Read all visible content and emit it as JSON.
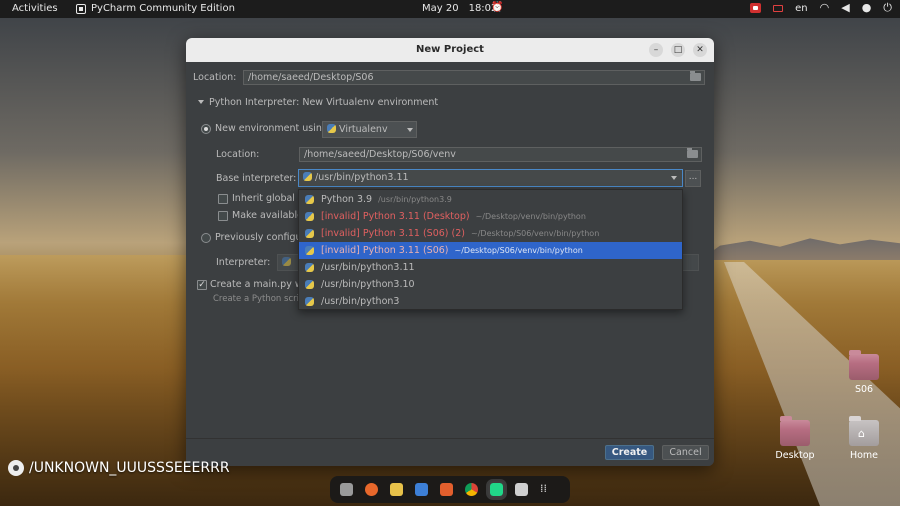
{
  "topbar": {
    "activities": "Activities",
    "app_name": "PyCharm Community Edition",
    "date": "May 20",
    "time": "18:02",
    "language": "en"
  },
  "dialog": {
    "title": "New Project",
    "location_label": "Location:",
    "location_value": "/home/saeed/Desktop/S06",
    "interpreter_section": "Python Interpreter: New Virtualenv environment",
    "new_env_label": "New environment using",
    "env_tool": "Virtualenv",
    "venv_location_label": "Location:",
    "venv_location_value": "/home/saeed/Desktop/S06/venv",
    "base_interpreter_label": "Base interpreter:",
    "base_interpreter_value": "/usr/bin/python3.11",
    "inherit_label": "Inherit global si",
    "make_available_label": "Make available",
    "previously_configured_label": "Previously configur",
    "interpreter_label": "Interpreter:",
    "create_main_label": "Create a main.py we",
    "create_main_hint": "Create a Python script",
    "create_button": "Create",
    "cancel_button": "Cancel",
    "dots_button": "..."
  },
  "popup": {
    "items": [
      {
        "name": "Python 3.9",
        "path": "/usr/bin/python3.9",
        "invalid": false,
        "selected": false
      },
      {
        "name": "[invalid] Python 3.11 (Desktop)",
        "path": "~/Desktop/venv/bin/python",
        "invalid": true,
        "selected": false
      },
      {
        "name": "[invalid] Python 3.11 (S06) (2)",
        "path": "~/Desktop/S06/venv/bin/python",
        "invalid": true,
        "selected": false
      },
      {
        "name": "[invalid] Python 3.11 (S06)",
        "path": "~/Desktop/S06/venv/bin/python",
        "invalid": true,
        "selected": true
      },
      {
        "name": "/usr/bin/python3.11",
        "path": "",
        "invalid": false,
        "selected": false
      },
      {
        "name": "/usr/bin/python3.10",
        "path": "",
        "invalid": false,
        "selected": false
      },
      {
        "name": "/usr/bin/python3",
        "path": "",
        "invalid": false,
        "selected": false
      }
    ]
  },
  "desktop": {
    "icons": [
      {
        "label": "S06"
      },
      {
        "label": "Desktop"
      },
      {
        "label": "Home"
      }
    ],
    "watermark": "/UNKNOWN_UUUSSSEEERRR"
  },
  "colors": {
    "accent": "#2f65ca",
    "invalid": "#e06060",
    "create_button": "#365880"
  }
}
